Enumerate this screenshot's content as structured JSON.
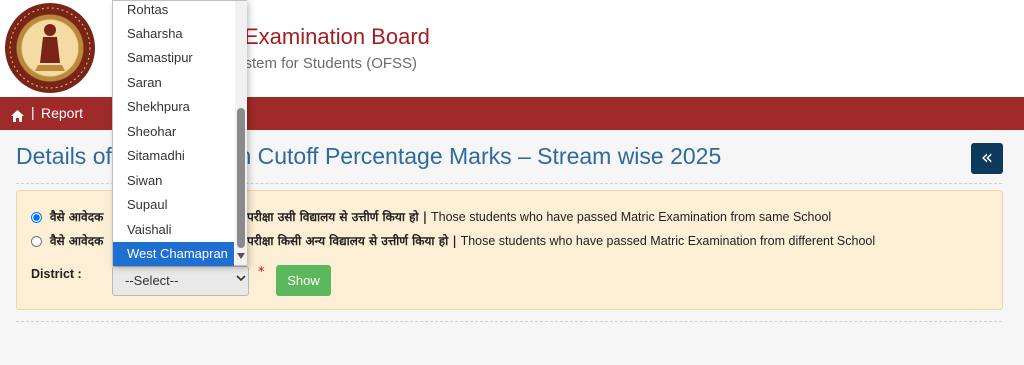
{
  "header": {
    "title": "Examination Board",
    "subtitle": "ystem for Students (OFSS)"
  },
  "nav": {
    "separator": "|",
    "report": "Report",
    "home_icon": "home-icon"
  },
  "page": {
    "title": "Details of",
    "title_rest": "on Cutoff Percentage Marks – Stream wise 2025",
    "back_icon": "double-chevron-left-icon",
    "back_glyph": "«"
  },
  "form": {
    "option1": {
      "hindi_left": "वैसे आवेदक",
      "hindi_right": "परीक्षा उसी विद्यालय से उत्तीर्ण किया हो |",
      "english": "Those students who have passed Matric Examination from same School",
      "checked": true
    },
    "option2": {
      "hindi_left": "वैसे आवेदक",
      "hindi_right": "परीक्षा किसी अन्य विद्यालय से उत्तीर्ण किया हो |",
      "english": "Those students who have passed Matric Examination from different School",
      "checked": false
    },
    "district_label": "District :",
    "district_selected": "--Select--",
    "required_mark": "*",
    "show_button": "Show"
  },
  "dropdown": {
    "options": [
      "Rohtas",
      "Saharsha",
      "Samastipur",
      "Saran",
      "Shekhpura",
      "Sheohar",
      "Sitamadhi",
      "Siwan",
      "Supaul",
      "Vaishali",
      "West Chamapran"
    ],
    "highlighted": "West Chamapran"
  },
  "colors": {
    "navbar": "#9e2a2a",
    "title_blue": "#2c6aa0",
    "panel": "#fcefd6",
    "show_green": "#5cb85c",
    "highlight": "#1f6fd1"
  }
}
